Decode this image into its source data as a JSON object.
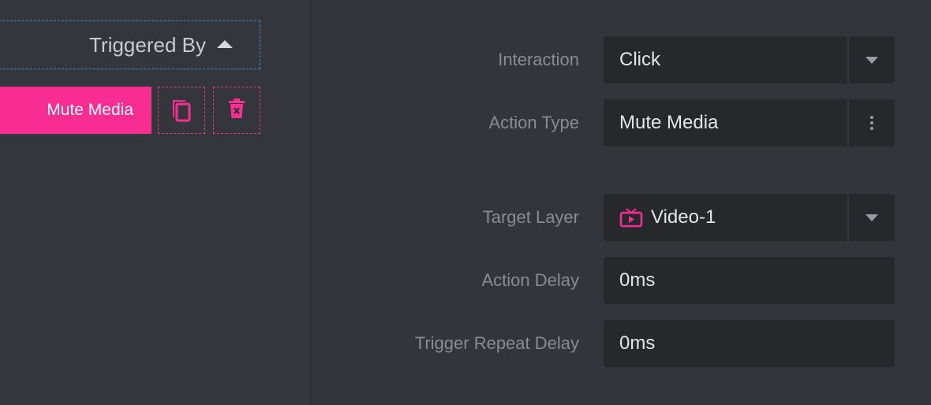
{
  "triggers": {
    "triggered_by_label": "Triggered By",
    "action_label": "Mute Media"
  },
  "form": {
    "interaction": {
      "label": "Interaction",
      "value": "Click"
    },
    "action_type": {
      "label": "Action Type",
      "value": "Mute Media"
    },
    "target_layer": {
      "label": "Target Layer",
      "value": "Video-1"
    },
    "action_delay": {
      "label": "Action Delay",
      "value": "0ms"
    },
    "trigger_repeat_delay": {
      "label": "Trigger Repeat Delay",
      "value": "0ms"
    }
  },
  "icons": {
    "triggered_by": "caret-up-icon",
    "copy": "copy-icon",
    "delete": "trash-icon",
    "dropdown": "chevron-down-icon",
    "more": "more-vertical-icon",
    "layer": "tv-icon"
  },
  "colors": {
    "accent": "#f72d91",
    "dashed_focus": "#3d8fd6",
    "panel_bg": "#34363b",
    "field_bg": "#27282c"
  }
}
